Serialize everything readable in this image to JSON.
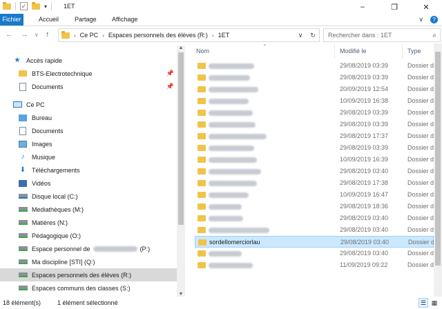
{
  "window": {
    "title": "1ET",
    "controls": [
      "–",
      "❐",
      "✕"
    ]
  },
  "ribbon": {
    "tabs": [
      "Fichier",
      "Accueil",
      "Partage",
      "Affichage"
    ],
    "expand": "∨",
    "help": "?"
  },
  "address": {
    "crumbs": [
      "Ce PC",
      "Espaces personnels des élèves (R:)",
      "1ET"
    ],
    "dropdown": "∨",
    "refresh": "↻"
  },
  "search": {
    "placeholder": "Rechercher dans : 1ET"
  },
  "nav": {
    "quick_access": "Accès rapide",
    "pinned": [
      {
        "label": "BTS-Electrotechnique",
        "icon": "folder-icon"
      },
      {
        "label": "Documents",
        "icon": "documents-icon"
      }
    ],
    "this_pc": "Ce PC",
    "pc_items": [
      {
        "label": "Bureau",
        "icon": "desktop-icon"
      },
      {
        "label": "Documents",
        "icon": "documents-icon"
      },
      {
        "label": "Images",
        "icon": "pictures-icon"
      },
      {
        "label": "Musique",
        "icon": "music-icon"
      },
      {
        "label": "Téléchargements",
        "icon": "downloads-icon"
      },
      {
        "label": "Vidéos",
        "icon": "videos-icon"
      },
      {
        "label": "Disque local (C:)",
        "icon": "local-disk-icon"
      },
      {
        "label": "Mediathèques (M:)",
        "icon": "network-drive-icon"
      },
      {
        "label": "Matières (N:)",
        "icon": "network-drive-icon"
      },
      {
        "label": "Pédagogique (O:)",
        "icon": "network-drive-icon"
      },
      {
        "label": "Espace personnel de",
        "suffix": "(P:)",
        "icon": "network-drive-icon"
      },
      {
        "label": "Ma discipline [STI] (Q:)",
        "icon": "network-drive-icon"
      },
      {
        "label": "Espaces personnels des élèves (R:)",
        "icon": "network-drive-icon",
        "selected": true
      },
      {
        "label": "Espaces communs des classes (S:)",
        "icon": "network-drive-icon"
      }
    ]
  },
  "columns": {
    "name": "Nom",
    "modified": "Modifié le",
    "type": "Type"
  },
  "files": [
    {
      "name": "",
      "date": "29/08/2019 03:39",
      "type": "Dossier de fi"
    },
    {
      "name": "",
      "date": "29/08/2019 03:39",
      "type": "Dossier de fi"
    },
    {
      "name": "",
      "date": "20/09/2019 12:54",
      "type": "Dossier de fi"
    },
    {
      "name": "",
      "date": "10/09/2019 16:38",
      "type": "Dossier de fi"
    },
    {
      "name": "",
      "date": "29/08/2019 03:39",
      "type": "Dossier de fi"
    },
    {
      "name": "",
      "date": "29/08/2019 03:39",
      "type": "Dossier de fi"
    },
    {
      "name": "",
      "date": "29/08/2019 17:37",
      "type": "Dossier de fi"
    },
    {
      "name": "",
      "date": "29/08/2019 03:39",
      "type": "Dossier de fi"
    },
    {
      "name": "",
      "date": "10/09/2019 16:39",
      "type": "Dossier de fi"
    },
    {
      "name": "",
      "date": "29/08/2019 03:40",
      "type": "Dossier de fi"
    },
    {
      "name": "",
      "date": "29/08/2019 17:38",
      "type": "Dossier de fi"
    },
    {
      "name": "",
      "date": "10/09/2019 16:47",
      "type": "Dossier de fi"
    },
    {
      "name": "",
      "date": "29/08/2019 18:36",
      "type": "Dossier de fi"
    },
    {
      "name": "",
      "date": "29/08/2019 03:40",
      "type": "Dossier de fi"
    },
    {
      "name": "",
      "date": "29/08/2019 03:40",
      "type": "Dossier de fi"
    },
    {
      "name": "sordellomerciorlau",
      "date": "29/08/2019 03:40",
      "type": "Dossier de fi",
      "selected": true
    },
    {
      "name": "",
      "date": "29/08/2019 03:40",
      "type": "Dossier de fi"
    },
    {
      "name": "",
      "date": "11/09/2019 09:22",
      "type": "Dossier de fi"
    }
  ],
  "status": {
    "count": "18 élément(s)",
    "selection": "1 élément sélectionné"
  },
  "colors": {
    "file_tab": "#1979ca",
    "selection": "#cce8ff",
    "folder": "#f1c34a"
  }
}
